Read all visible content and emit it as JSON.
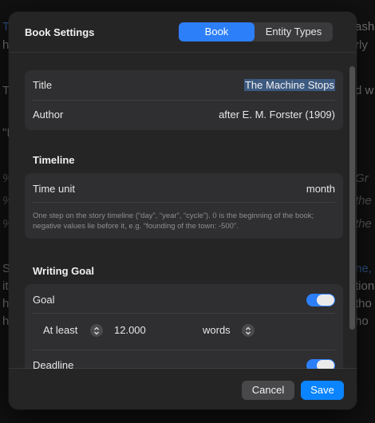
{
  "background": {
    "lines": [
      "T",
      "h",
      "T",
      "\"I",
      "%",
      "%",
      "%",
      "S",
      "it",
      "h",
      "h"
    ],
    "right_fragments": [
      "ash",
      "rly",
      "d w",
      "Gr",
      "the",
      "the",
      "ne,",
      "tion",
      "tho",
      "ho"
    ]
  },
  "dialog": {
    "title": "Book Settings",
    "tabs": [
      {
        "label": "Book",
        "active": true
      },
      {
        "label": "Entity Types",
        "active": false
      }
    ],
    "book": {
      "title_label": "Title",
      "title_value": "The Machine Stops",
      "author_label": "Author",
      "author_value": "after E. M. Forster (1909)"
    },
    "timeline": {
      "section_title": "Timeline",
      "unit_label": "Time unit",
      "unit_value": "month",
      "hint": "One step on the story timeline (“day”, “year”, “cycle”). 0 is the beginning of the book; negative values lie before it, e.g. “founding of the town: -500”."
    },
    "writing_goal": {
      "section_title": "Writing Goal",
      "goal_label": "Goal",
      "goal_enabled": true,
      "comparator": "At least",
      "amount": "12.000",
      "unit": "words",
      "deadline_label": "Deadline",
      "deadline_enabled": true
    },
    "buttons": {
      "cancel": "Cancel",
      "save": "Save"
    },
    "colors": {
      "accent": "#2d7ff9",
      "save_button": "#0a84ff",
      "sheet_bg": "#252526",
      "group_bg": "#2f2f31",
      "selection": "#3d5a80"
    }
  }
}
